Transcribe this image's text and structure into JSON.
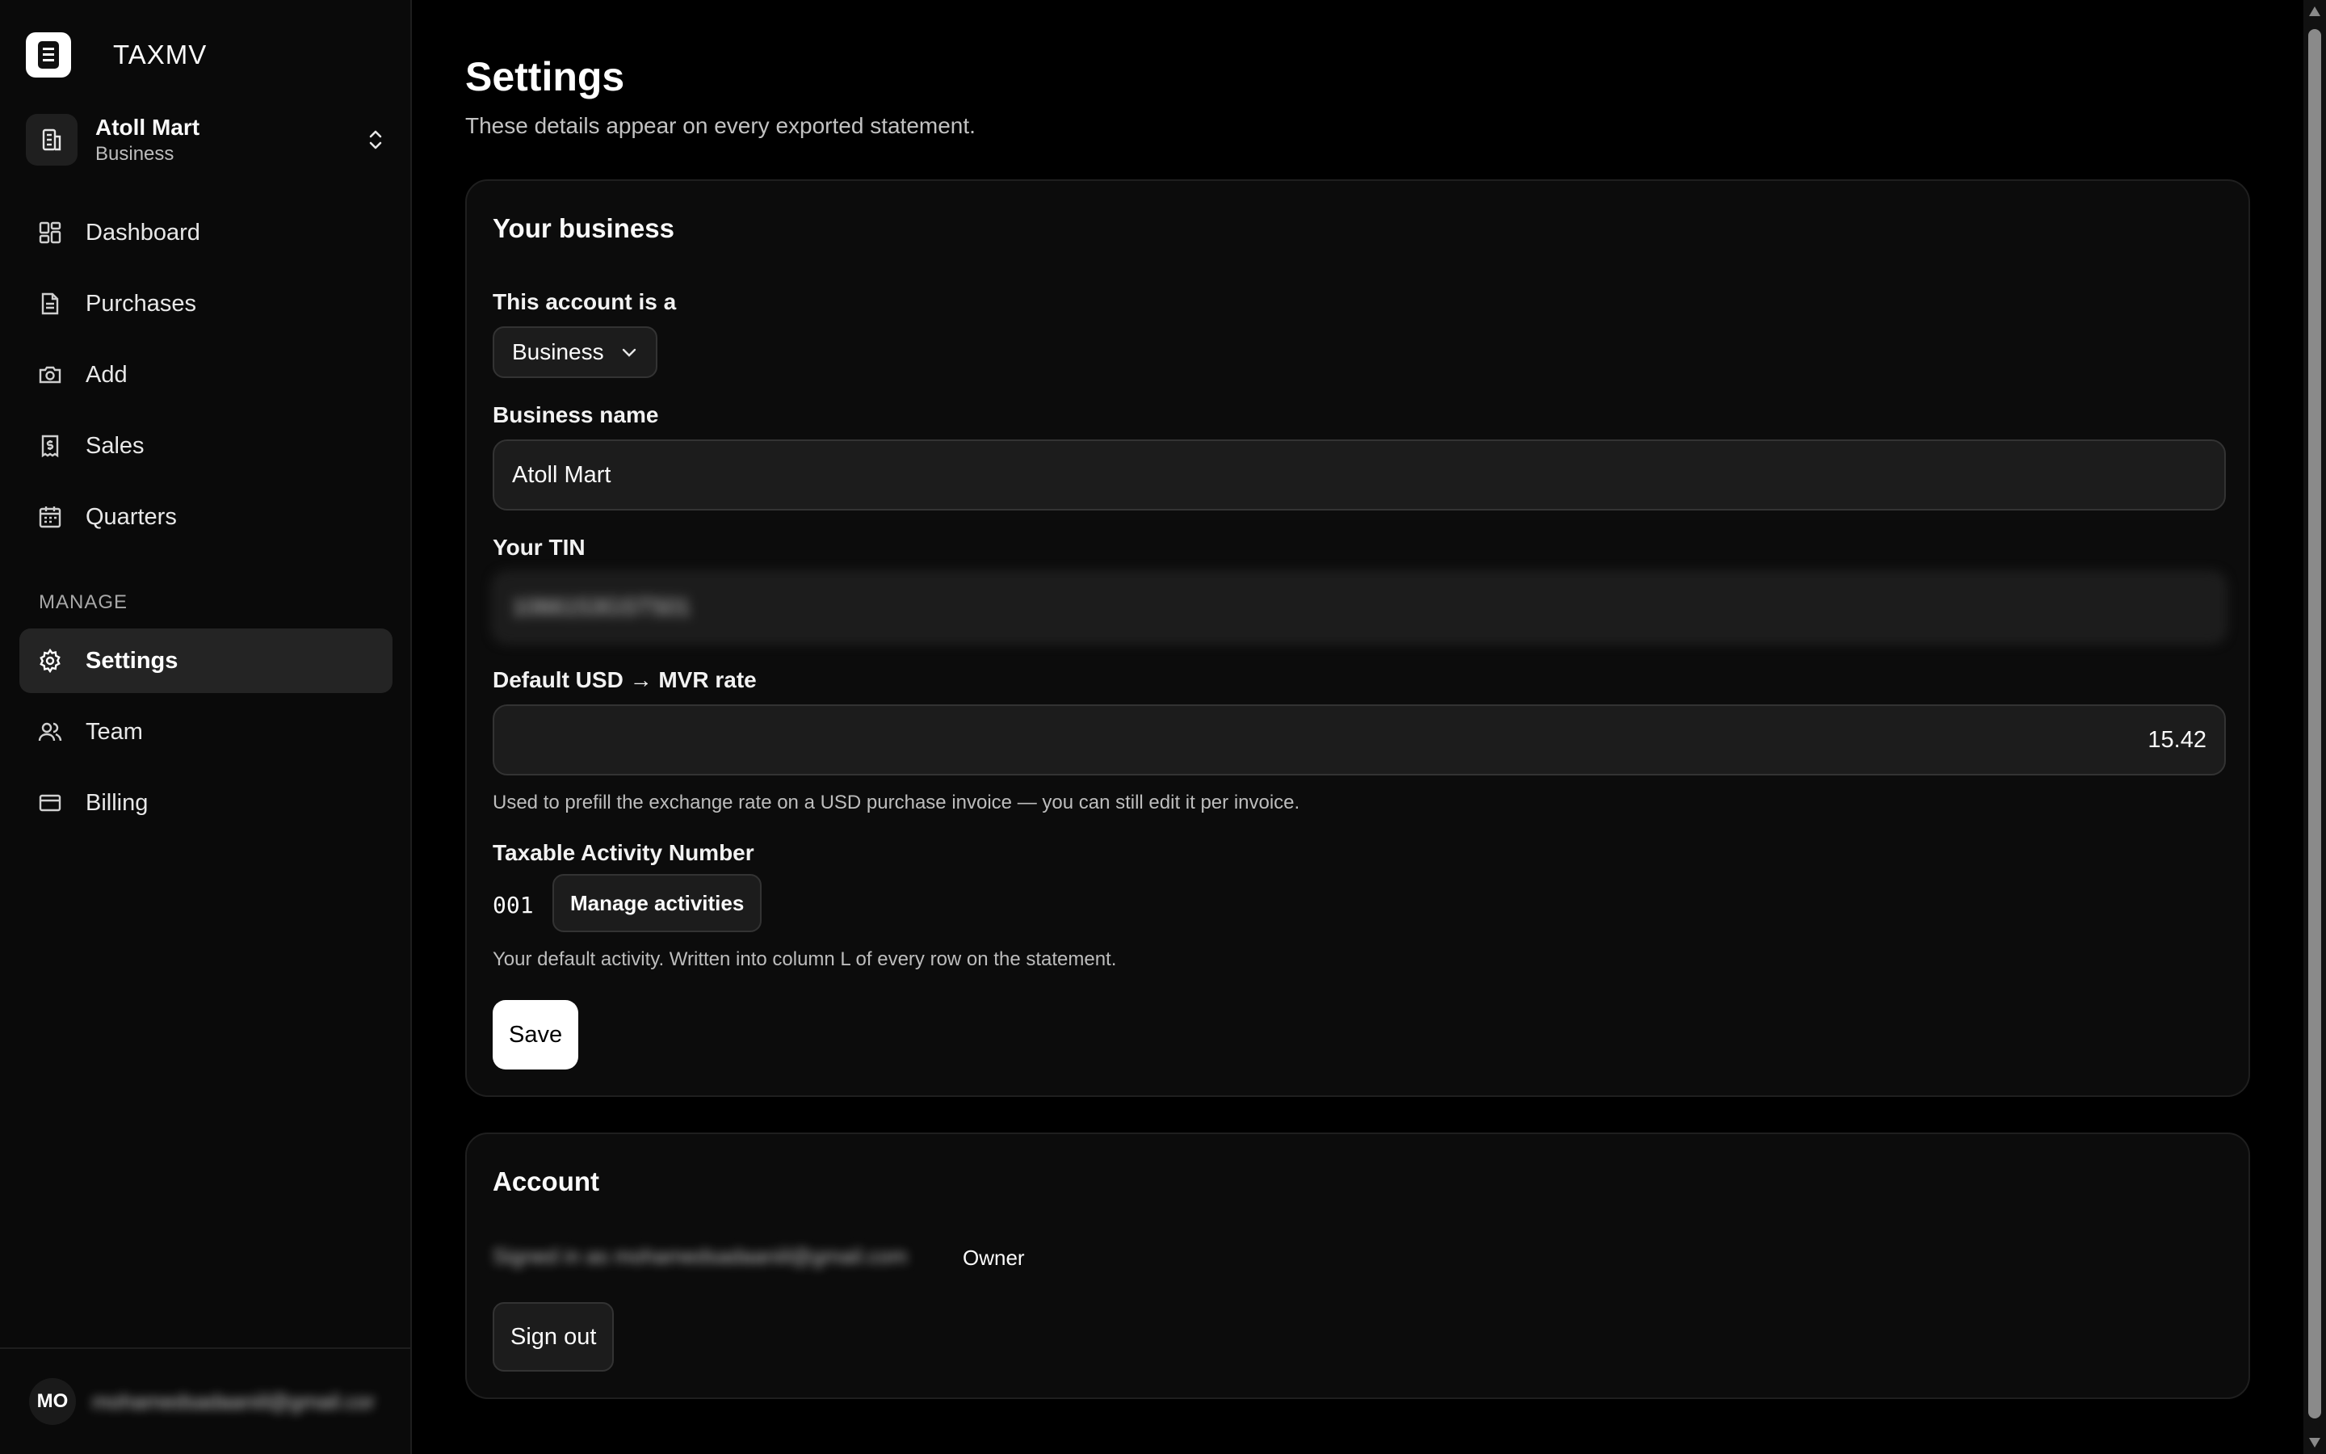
{
  "app": {
    "name": "TAXMV"
  },
  "org": {
    "name": "Atoll Mart",
    "type": "Business"
  },
  "nav": {
    "items": [
      {
        "label": "Dashboard",
        "icon": "grid-icon"
      },
      {
        "label": "Purchases",
        "icon": "document-icon"
      },
      {
        "label": "Add",
        "icon": "camera-icon"
      },
      {
        "label": "Sales",
        "icon": "receipt-dollar-icon"
      },
      {
        "label": "Quarters",
        "icon": "calendar-icon"
      }
    ],
    "section_label": "MANAGE",
    "manage_items": [
      {
        "label": "Settings",
        "icon": "gear-icon",
        "active": true
      },
      {
        "label": "Team",
        "icon": "users-icon"
      },
      {
        "label": "Billing",
        "icon": "credit-card-icon"
      }
    ]
  },
  "user": {
    "initials": "MO",
    "email": "mohamedsadaaniil@gmail.com"
  },
  "page": {
    "title": "Settings",
    "subtitle": "These details appear on every exported statement."
  },
  "business_card": {
    "title": "Your business",
    "account_type_label": "This account is a",
    "account_type_value": "Business",
    "business_name_label": "Business name",
    "business_name_value": "Atoll Mart",
    "tin_label": "Your TIN",
    "tin_value": "1066153GST501",
    "rate_label": "Default USD → MVR rate",
    "rate_value": "15.42",
    "rate_hint": "Used to prefill the exchange rate on a USD purchase invoice — you can still edit it per invoice.",
    "activity_label": "Taxable Activity Number",
    "activity_code": "001",
    "manage_activities_label": "Manage activities",
    "activity_hint": "Your default activity. Written into column L of every row on the statement.",
    "save_label": "Save"
  },
  "account_card": {
    "title": "Account",
    "signed_in_as": "Signed in as mohamedsadaaniil@gmail.com",
    "role": "Owner",
    "sign_out_label": "Sign out"
  },
  "colors": {
    "background": "#000000",
    "sidebar": "#0a0a0a",
    "card": "#0c0c0c",
    "primary_button": "#ffffff"
  }
}
